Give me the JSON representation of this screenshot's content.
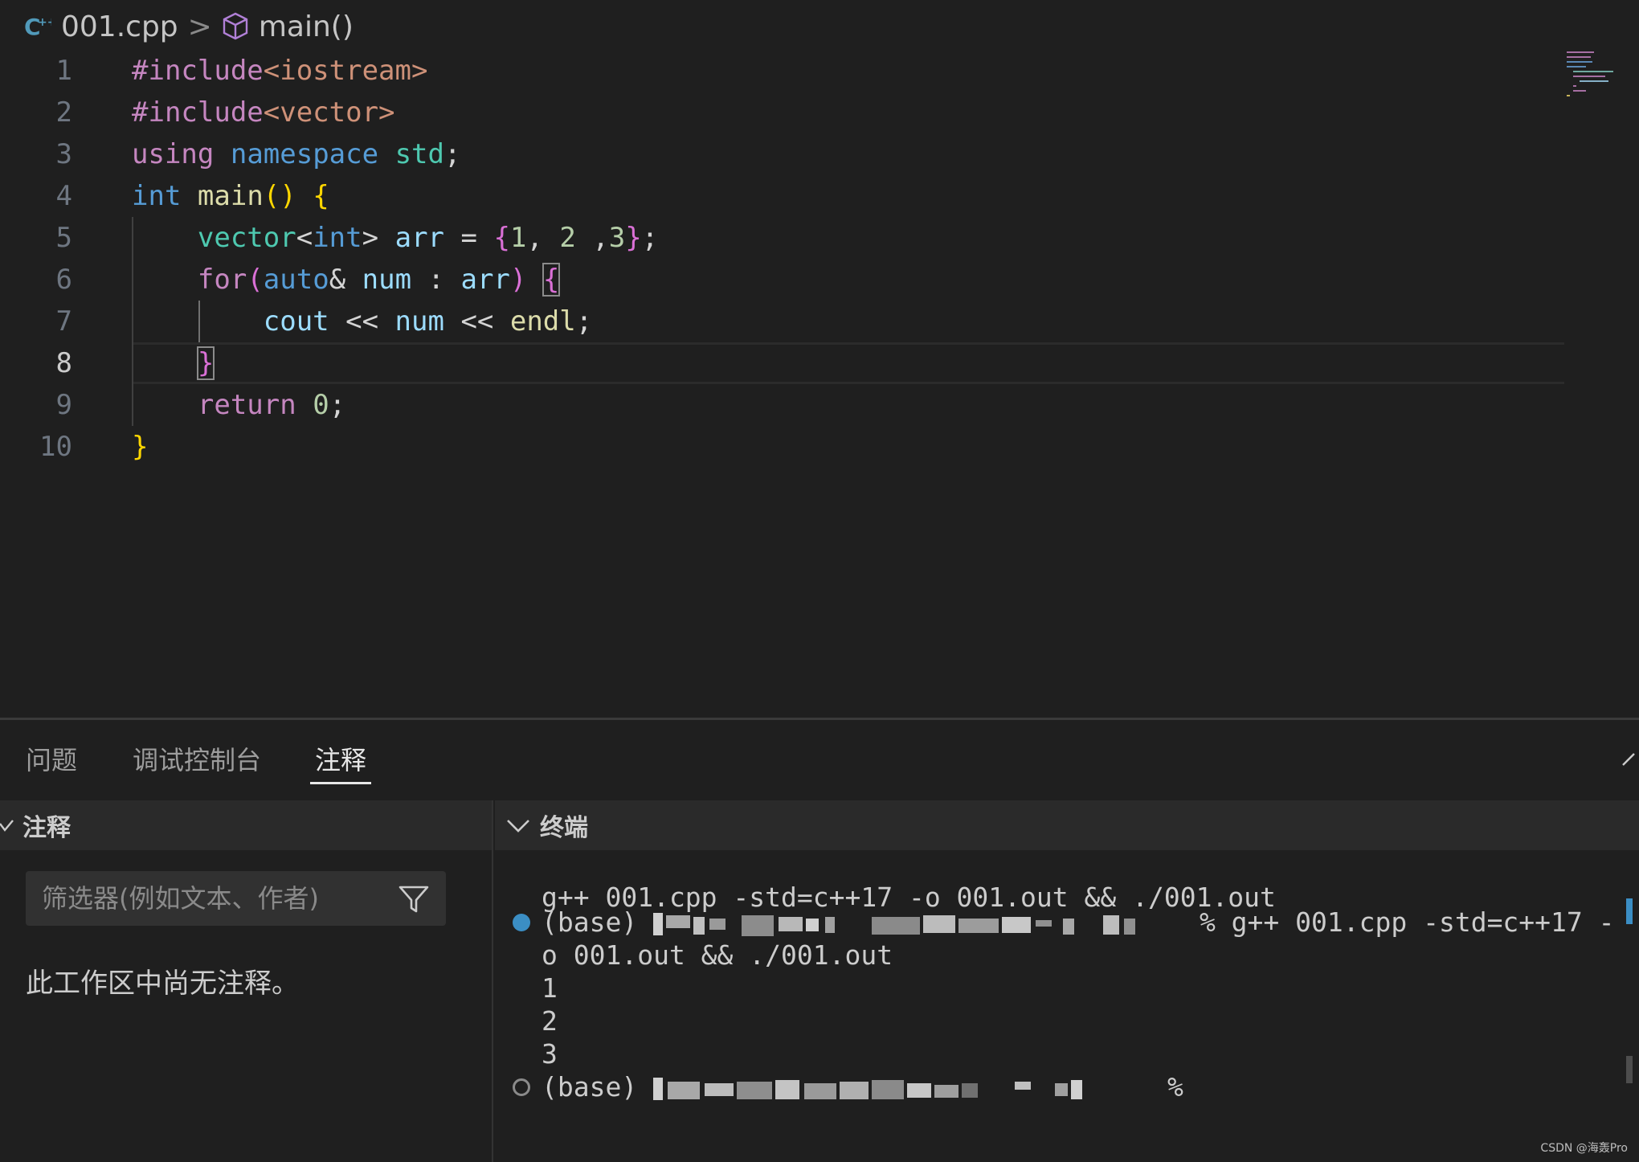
{
  "breadcrumb": {
    "file": "001.cpp",
    "separator": ">",
    "symbol": "main()"
  },
  "editor": {
    "current_line": 8,
    "lines": [
      {
        "number": "1",
        "tokens": [
          {
            "t": "#include",
            "c": "k-pre"
          },
          {
            "t": "<iostream>",
            "c": "k-inc"
          }
        ]
      },
      {
        "number": "2",
        "tokens": [
          {
            "t": "#include",
            "c": "k-pre"
          },
          {
            "t": "<vector>",
            "c": "k-inc"
          }
        ]
      },
      {
        "number": "3",
        "tokens": [
          {
            "t": "using",
            "c": "k-ctl"
          },
          {
            "t": " ",
            "c": ""
          },
          {
            "t": "namespace",
            "c": "k-kw"
          },
          {
            "t": " ",
            "c": ""
          },
          {
            "t": "std",
            "c": "k-ns"
          },
          {
            "t": ";",
            "c": "k-op"
          }
        ]
      },
      {
        "number": "4",
        "tokens": [
          {
            "t": "int",
            "c": "k-kw"
          },
          {
            "t": " ",
            "c": ""
          },
          {
            "t": "main",
            "c": "k-fn"
          },
          {
            "t": "()",
            "c": "b1"
          },
          {
            "t": " ",
            "c": ""
          },
          {
            "t": "{",
            "c": "b1"
          }
        ]
      },
      {
        "number": "5",
        "tokens": [
          {
            "t": "    ",
            "c": ""
          },
          {
            "t": "vector",
            "c": "k-type"
          },
          {
            "t": "<",
            "c": "k-op"
          },
          {
            "t": "int",
            "c": "k-kw"
          },
          {
            "t": ">",
            "c": "k-op"
          },
          {
            "t": " ",
            "c": ""
          },
          {
            "t": "arr",
            "c": "k-var"
          },
          {
            "t": " = ",
            "c": "k-op"
          },
          {
            "t": "{",
            "c": "b2"
          },
          {
            "t": "1",
            "c": "k-num"
          },
          {
            "t": ", ",
            "c": "k-op"
          },
          {
            "t": "2",
            "c": "k-num"
          },
          {
            "t": " ,",
            "c": "k-op"
          },
          {
            "t": "3",
            "c": "k-num"
          },
          {
            "t": "}",
            "c": "b2"
          },
          {
            "t": ";",
            "c": "k-op"
          }
        ]
      },
      {
        "number": "6",
        "tokens": [
          {
            "t": "    ",
            "c": ""
          },
          {
            "t": "for",
            "c": "k-ctl"
          },
          {
            "t": "(",
            "c": "b2"
          },
          {
            "t": "auto",
            "c": "k-kw"
          },
          {
            "t": "& ",
            "c": "k-op"
          },
          {
            "t": "num",
            "c": "k-var"
          },
          {
            "t": " : ",
            "c": "k-op"
          },
          {
            "t": "arr",
            "c": "k-var"
          },
          {
            "t": ")",
            "c": "b2"
          },
          {
            "t": " ",
            "c": ""
          },
          {
            "t": "{",
            "c": "b2 bracket-box"
          }
        ]
      },
      {
        "number": "7",
        "tokens": [
          {
            "t": "        ",
            "c": ""
          },
          {
            "t": "cout",
            "c": "k-var"
          },
          {
            "t": " << ",
            "c": "k-op"
          },
          {
            "t": "num",
            "c": "k-var"
          },
          {
            "t": " << ",
            "c": "k-op"
          },
          {
            "t": "endl",
            "c": "k-fn"
          },
          {
            "t": ";",
            "c": "k-op"
          }
        ]
      },
      {
        "number": "8",
        "tokens": [
          {
            "t": "    ",
            "c": ""
          },
          {
            "t": "}",
            "c": "b2 bracket-box"
          }
        ]
      },
      {
        "number": "9",
        "tokens": [
          {
            "t": "    ",
            "c": ""
          },
          {
            "t": "return",
            "c": "k-ctl"
          },
          {
            "t": " ",
            "c": ""
          },
          {
            "t": "0",
            "c": "k-num"
          },
          {
            "t": ";",
            "c": "k-op"
          }
        ]
      },
      {
        "number": "10",
        "tokens": [
          {
            "t": "}",
            "c": "b1"
          }
        ]
      }
    ]
  },
  "panel": {
    "tabs": [
      "问题",
      "调试控制台",
      "注释"
    ],
    "active_tab": "注释",
    "comments": {
      "header": "注释",
      "filter_placeholder": "筛选器(例如文本、作者)",
      "empty_message": "此工作区中尚无注释。"
    },
    "terminal": {
      "header": "终端",
      "lines": {
        "cmd": "g++ 001.cpp -std=c++17 -o 001.out && ./001.out",
        "prompt1_prefix": "(base) ",
        "prompt1_suffix": " % g++ 001.cpp -std=c++17 -",
        "prompt1_wrap": "o 001.out && ./001.out",
        "out1": "1",
        "out2": "2",
        "out3": "3",
        "prompt2_prefix": "(base) ",
        "prompt2_suffix": " %"
      }
    }
  },
  "watermark": "CSDN @海轰Pro",
  "colors": {
    "background": "#1f1f1f",
    "accent": "#3b8ec4"
  }
}
